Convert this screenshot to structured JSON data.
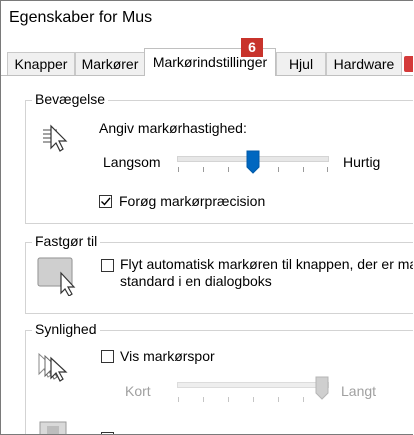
{
  "window": {
    "title": "Egenskaber for Mus"
  },
  "tabs": [
    {
      "label": "Knapper"
    },
    {
      "label": "Markører"
    },
    {
      "label": "Markørindstillinger"
    },
    {
      "label": "Hjul"
    },
    {
      "label": "Hardware"
    }
  ],
  "annotation": {
    "badge": "6",
    "color": "#c8332b"
  },
  "motion": {
    "legend": "Bevægelse",
    "speed_label": "Angiv markørhastighed:",
    "slow": "Langsom",
    "fast": "Hurtig",
    "speed_value_fraction": 0.5,
    "precision_label": "Forøg markørpræcision",
    "precision_checked": true,
    "accent": "#0067c0"
  },
  "snap": {
    "legend": "Fastgør til",
    "line1": "Flyt automatisk markøren til knappen, der er ma",
    "line2": "standard i en dialogboks",
    "checked": false
  },
  "visibility": {
    "legend": "Synlighed",
    "trails_label": "Vis markørspor",
    "trails_checked": false,
    "short": "Kort",
    "long": "Langt",
    "trail_value_fraction": 1.0
  }
}
